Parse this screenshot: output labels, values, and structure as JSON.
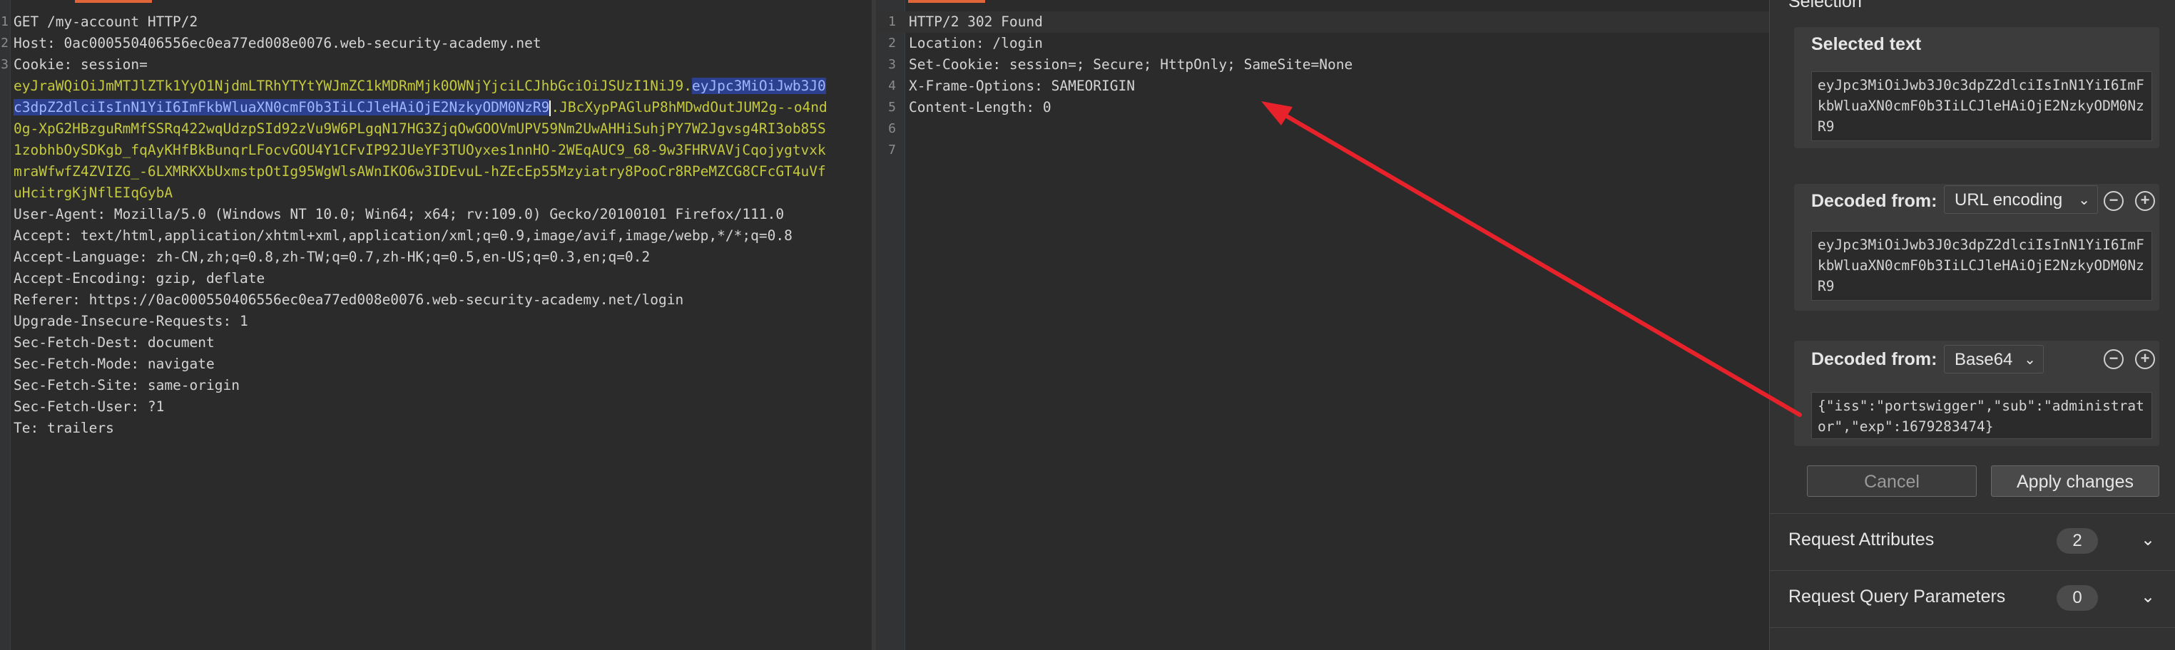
{
  "request": {
    "lines": [
      {
        "n": "1",
        "name": "",
        "value": "GET /my-account HTTP/2"
      },
      {
        "n": "2",
        "name": "Host: ",
        "value": "0ac000550406556ec0ea77ed008e0076.web-security-academy.net"
      },
      {
        "n": "3",
        "name": "Cookie: ",
        "value": "session="
      },
      {
        "n": "",
        "cookie": "eyJraWQiOiJmMTJlZTk1YyO1NjdmLTRhYTYtYWJmZC1kMDRmMjk0OWNjYjciLCJhbGciOiJSUzI1NiJ9.",
        "selected": "eyJpc3MiOiJwb3J0"
      },
      {
        "n": "",
        "selected_start": "c3dpZ2dlciIsInN1YiI6ImFkbWluaXN0cmF0b3IiLCJleHAiOjE2NzkyODM0NzR9",
        "cookie_tail": ".JBcXypPAGluP8hMDwdOutJUM2g--o4nd"
      },
      {
        "n": "",
        "cookie": "0g-XpG2HBzguRmMfSSRq422wqUdzpSId92zVu9W6PLgqN17HG3ZjqOwGOOVmUPV59Nm2UwAHHiSuhjPY7W2Jgvsg4RI3ob85S"
      },
      {
        "n": "",
        "cookie": "1zobhbOySDKgb_fqAyKHfBkBunqrLFocvGOU4Y1CFvIP92JUeYF3TUOyxes1nnHO-2WEqAUC9_68-9w3FHRVAVjCqojygtvxk"
      },
      {
        "n": "",
        "cookie": "mraWfwfZ4ZVIZG_-6LXMRKXbUxmstpOtIg95WgWlsAWnIKO6w3IDEvuL-hZEcEp55Mzyiatry8PooCr8RPeMZCG8CFcGT4uVf"
      },
      {
        "n": "",
        "cookie": "uHcitrgKjNflEIqGybA"
      },
      {
        "n": "",
        "name": "User-Agent: ",
        "value": "Mozilla/5.0 (Windows NT 10.0; Win64; x64; rv:109.0) Gecko/20100101 Firefox/111.0"
      },
      {
        "n": "",
        "name": "Accept: ",
        "value": "text/html,application/xhtml+xml,application/xml;q=0.9,image/avif,image/webp,*/*;q=0.8"
      },
      {
        "n": "",
        "name": "Accept-Language: ",
        "value": "zh-CN,zh;q=0.8,zh-TW;q=0.7,zh-HK;q=0.5,en-US;q=0.3,en;q=0.2"
      },
      {
        "n": "",
        "name": "Accept-Encoding: ",
        "value": "gzip, deflate"
      },
      {
        "n": "",
        "name": "Referer: ",
        "value": "https://0ac000550406556ec0ea77ed008e0076.web-security-academy.net/login"
      },
      {
        "n": "",
        "name": "Upgrade-Insecure-Requests: ",
        "value": "1"
      },
      {
        "n": "",
        "name": "Sec-Fetch-Dest: ",
        "value": "document"
      },
      {
        "n": "",
        "name": "Sec-Fetch-Mode: ",
        "value": "navigate"
      },
      {
        "n": "",
        "name": "Sec-Fetch-Site: ",
        "value": "same-origin"
      },
      {
        "n": "",
        "name": "Sec-Fetch-User: ",
        "value": "?1"
      },
      {
        "n": "",
        "name": "Te: ",
        "value": "trailers"
      }
    ]
  },
  "response": {
    "lines": [
      {
        "n": "1",
        "name": "",
        "value": "HTTP/2 302 Found"
      },
      {
        "n": "2",
        "name": "Location: ",
        "value": "/login"
      },
      {
        "n": "3",
        "name": "Set-Cookie: ",
        "value": "session=; Secure; HttpOnly; SameSite=None"
      },
      {
        "n": "4",
        "name": "X-Frame-Options: ",
        "value": "SAMEORIGIN"
      },
      {
        "n": "5",
        "name": "Content-Length: ",
        "value": "0"
      },
      {
        "n": "6",
        "name": "",
        "value": ""
      },
      {
        "n": "7",
        "name": "",
        "value": ""
      }
    ]
  },
  "inspector": {
    "top_title": "Selection",
    "selected_text": {
      "title": "Selected text",
      "value": "eyJpc3MiOiJwb3J0c3dpZ2dlciIsInN1YiI6ImFkbWluaXN0cmF0b3IiLCJleHAiOjE2NzkyODM0NzR9"
    },
    "decoded_1": {
      "title": "Decoded from:",
      "encoding": "URL encoding",
      "value": "eyJpc3MiOiJwb3J0c3dpZ2dlciIsInN1YiI6ImFkbWluaXN0cmF0b3IiLCJleHAiOjE2NzkyODM0NzR9"
    },
    "decoded_2": {
      "title": "Decoded from:",
      "encoding": "Base64",
      "value": "{\"iss\":\"portswigger\",\"sub\":\"administrator\",\"exp\":1679283474}"
    },
    "cancel_label": "Cancel",
    "apply_label": "Apply changes",
    "sections": [
      {
        "label": "Request Attributes",
        "count": "2"
      },
      {
        "label": "Request Query Parameters",
        "count": "0"
      }
    ]
  },
  "colors": {
    "accent": "#e0663a",
    "arrow": "#e8222a",
    "selection": "#2d3f8f",
    "cookie_text": "#c4c93d"
  }
}
